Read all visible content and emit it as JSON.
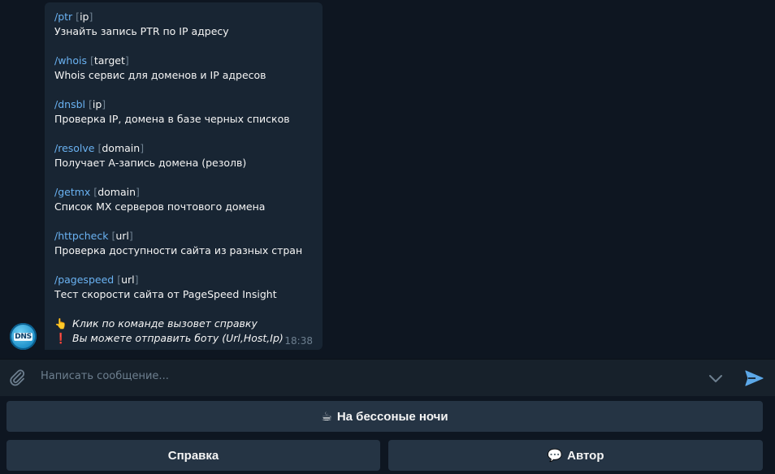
{
  "message": {
    "commands": [
      {
        "name": "/ptr",
        "arg": "ip",
        "desc": "Узнайть запись PTR по IP адресу"
      },
      {
        "name": "/whois",
        "arg": "target",
        "desc": "Whois сервис для доменов и IP адресов"
      },
      {
        "name": "/dnsbl",
        "arg": "ip",
        "desc": "Проверка IP, домена в базе черных списков"
      },
      {
        "name": "/resolve",
        "arg": "domain",
        "desc": "Получает A-запись домена (резолв)"
      },
      {
        "name": "/getmx",
        "arg": "domain",
        "desc": "Список MX серверов почтового домена"
      },
      {
        "name": "/httpcheck",
        "arg": "url",
        "desc": "Проверка доступности сайта из разных стран"
      },
      {
        "name": "/pagespeed",
        "arg": "url",
        "desc": "Тест скорости сайта от PageSpeed Insight"
      }
    ],
    "notes": [
      {
        "emoji": "👆",
        "text": "Клик по команде вызовет справку"
      },
      {
        "emoji": "❗",
        "text": "Вы можете отправить боту (Url,Host,Ip)"
      }
    ],
    "time": "18:38"
  },
  "avatar": {
    "text": "DNS"
  },
  "compose": {
    "placeholder": "Написать сообщение..."
  },
  "keyboard": {
    "row1": {
      "emoji": "☕",
      "label": "На бессоные ночи"
    },
    "row2": [
      {
        "emoji": "",
        "label": "Справка"
      },
      {
        "emoji": "💬",
        "label": "Автор"
      }
    ]
  },
  "colors": {
    "background": "#0e1621",
    "bubble": "#182533",
    "link": "#6ab2f2",
    "muted": "#6d7f8f",
    "button": "#253444"
  }
}
